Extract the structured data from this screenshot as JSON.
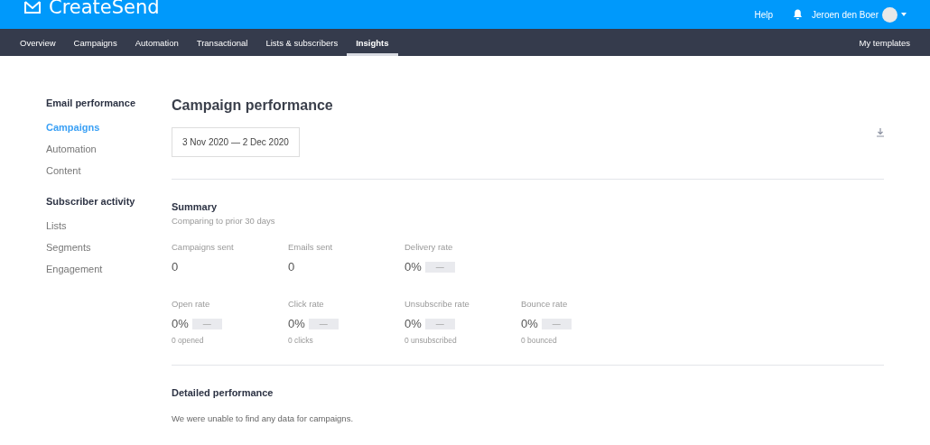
{
  "header": {
    "logo": "CreateSend",
    "help": "Help",
    "user": "Jeroen den Boer"
  },
  "nav": {
    "items": [
      {
        "label": "Overview",
        "selected": false
      },
      {
        "label": "Campaigns",
        "selected": false
      },
      {
        "label": "Automation",
        "selected": false
      },
      {
        "label": "Transactional",
        "selected": false
      },
      {
        "label": "Lists & subscribers",
        "selected": false
      },
      {
        "label": "Insights",
        "selected": true
      }
    ],
    "right": "My templates"
  },
  "sidebar": {
    "sections": [
      {
        "heading": "Email performance",
        "items": [
          {
            "label": "Campaigns",
            "selected": true
          },
          {
            "label": "Automation",
            "selected": false
          },
          {
            "label": "Content",
            "selected": false
          }
        ]
      },
      {
        "heading": "Subscriber activity",
        "items": [
          {
            "label": "Lists",
            "selected": false
          },
          {
            "label": "Segments",
            "selected": false
          },
          {
            "label": "Engagement",
            "selected": false
          }
        ]
      }
    ]
  },
  "main": {
    "title": "Campaign performance",
    "date_range": "3 Nov 2020 — 2 Dec 2020",
    "summary": {
      "heading": "Summary",
      "subheading": "Comparing to prior 30 days",
      "rows": [
        [
          {
            "label": "Campaigns sent",
            "value": "0"
          },
          {
            "label": "Emails sent",
            "value": "0"
          },
          {
            "label": "Delivery rate",
            "value": "0%",
            "delta": "—"
          }
        ],
        [
          {
            "label": "Open rate",
            "value": "0%",
            "delta": "—",
            "note": "0 opened"
          },
          {
            "label": "Click rate",
            "value": "0%",
            "delta": "—",
            "note": "0 clicks"
          },
          {
            "label": "Unsubscribe rate",
            "value": "0%",
            "delta": "—",
            "note": "0 unsubscribed"
          },
          {
            "label": "Bounce rate",
            "value": "0%",
            "delta": "—",
            "note": "0 bounced"
          }
        ]
      ]
    },
    "detailed": {
      "heading": "Detailed performance",
      "message": "We were unable to find any data for campaigns."
    }
  }
}
